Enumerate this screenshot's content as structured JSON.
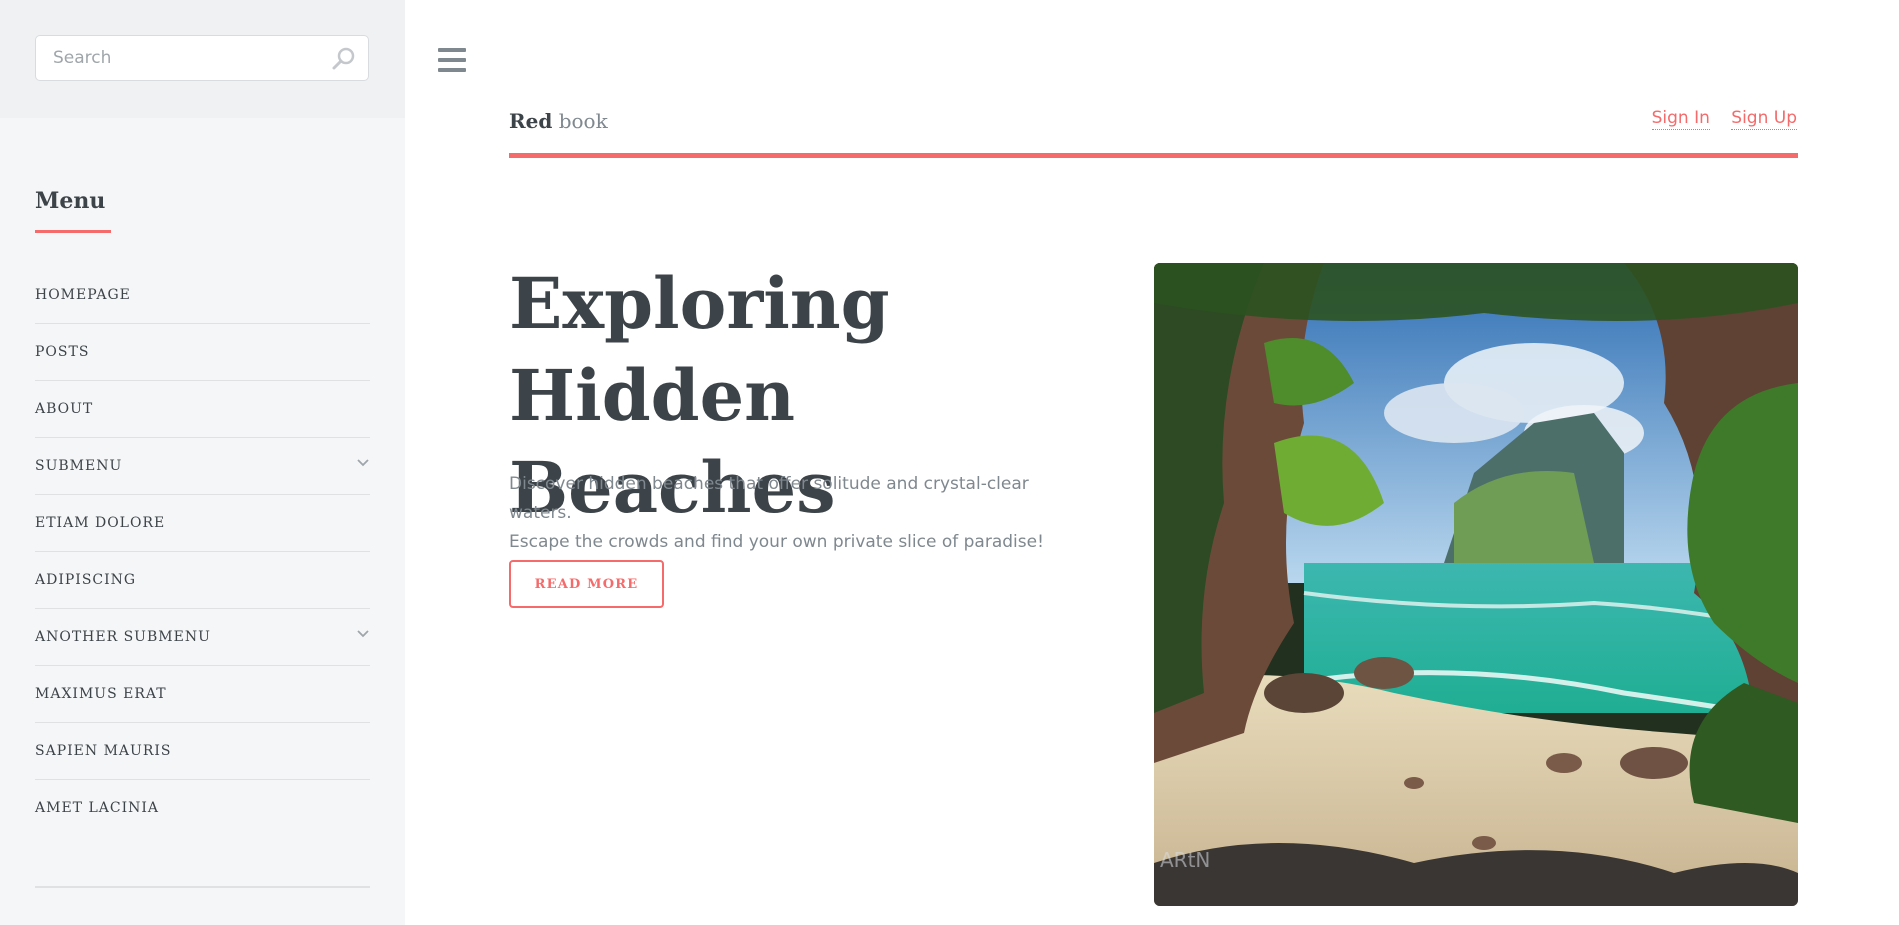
{
  "search": {
    "placeholder": "Search"
  },
  "menu": {
    "title": "Menu",
    "items": [
      {
        "label": "HOMEPAGE"
      },
      {
        "label": "POSTS"
      },
      {
        "label": "ABOUT"
      },
      {
        "label": "SUBMENU"
      },
      {
        "label": "ETIAM DOLORE"
      },
      {
        "label": "ADIPISCING"
      },
      {
        "label": "ANOTHER SUBMENU"
      },
      {
        "label": "MAXIMUS ERAT"
      },
      {
        "label": "SAPIEN MAURIS"
      },
      {
        "label": "AMET LACINIA"
      }
    ]
  },
  "header": {
    "logo_strong": "Red",
    "logo_light": "book",
    "sign_in": "Sign In",
    "sign_up": "Sign Up"
  },
  "banner": {
    "title_line1": "Exploring",
    "title_line2": "Hidden Beaches",
    "description_line1": "Discover hidden beaches that offer solitude and crystal-clear waters.",
    "description_line2": "Escape the crowds and find your own private slice of paradise!",
    "button_label": "READ MORE",
    "image_signature": "ARtN"
  },
  "colors": {
    "accent": "#f56a6a",
    "text": "#3d4449",
    "muted": "#7f888f",
    "sidebar_bg": "#f5f6f7"
  },
  "icons": [
    "search-icon",
    "hamburger-menu-icon",
    "chevron-down-icon"
  ]
}
